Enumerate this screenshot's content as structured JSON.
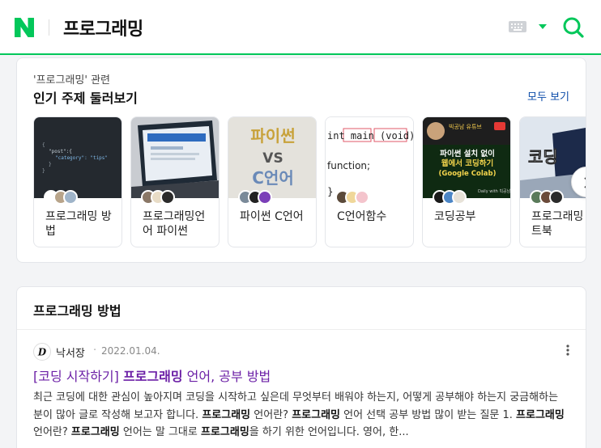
{
  "header": {
    "logo_letter": "N",
    "query": "프로그래밍",
    "accent": "#03c75a"
  },
  "related": {
    "label": "'프로그래밍' 관련",
    "title": "인기 주제 둘러보기",
    "see_all": "모두 보기",
    "tiles": [
      {
        "label": "프로그래밍 방법",
        "thumb_text": [
          "{",
          "\"post\":{",
          "\"category\": \"tips\"",
          "}",
          "}"
        ]
      },
      {
        "label": "프로그래밍언어 파이썬"
      },
      {
        "label": "파이썬 C언어",
        "thumb_text": [
          "파이썬",
          "VS",
          "C언어"
        ]
      },
      {
        "label": "C언어함수",
        "thumb_text": [
          "int main (void)",
          "function;",
          "}"
        ]
      },
      {
        "label": "코딩공부",
        "thumb_text": [
          "빅공남 유튜브",
          "파이썬 설치 없이",
          "웹에서 코딩하기",
          "(Google Colab)",
          "Daily with 빅공남"
        ]
      },
      {
        "label": "프로그래밍 노트북",
        "thumb_text": [
          "코딩"
        ]
      }
    ]
  },
  "section": {
    "title": "프로그래밍 방법",
    "post": {
      "blog_initial": "D",
      "blog_name": "낙서장",
      "dot": "·",
      "date": "2022.01.04.",
      "title_prefix": "[코딩 시작하기] ",
      "title_keyword": "프로그래밍",
      "title_suffix": " 언어, 공부 방법",
      "snippet": [
        {
          "t": "최근 코딩에 대한 관심이 높아지며 코딩을 시작하고 싶은데 무엇부터 배워야 하는지, 어떻게 공부해야 하는지 궁금해하는 분이 많아 글로 작성해 보고자 합니다. ",
          "b": false
        },
        {
          "t": "프로그래밍",
          "b": true
        },
        {
          "t": " 언어란? ",
          "b": false
        },
        {
          "t": "프로그래밍",
          "b": true
        },
        {
          "t": " 언어 선택 공부 방법 많이 받는 질문 1. ",
          "b": false
        },
        {
          "t": "프로그래밍",
          "b": true
        },
        {
          "t": " 언어란? ",
          "b": false
        },
        {
          "t": "프로그래밍",
          "b": true
        },
        {
          "t": " 언어는 말 그대로 ",
          "b": false
        },
        {
          "t": "프로그래밍",
          "b": true
        },
        {
          "t": "을 하기 위한 언어입니다. 영어, 한...",
          "b": false
        }
      ]
    }
  }
}
